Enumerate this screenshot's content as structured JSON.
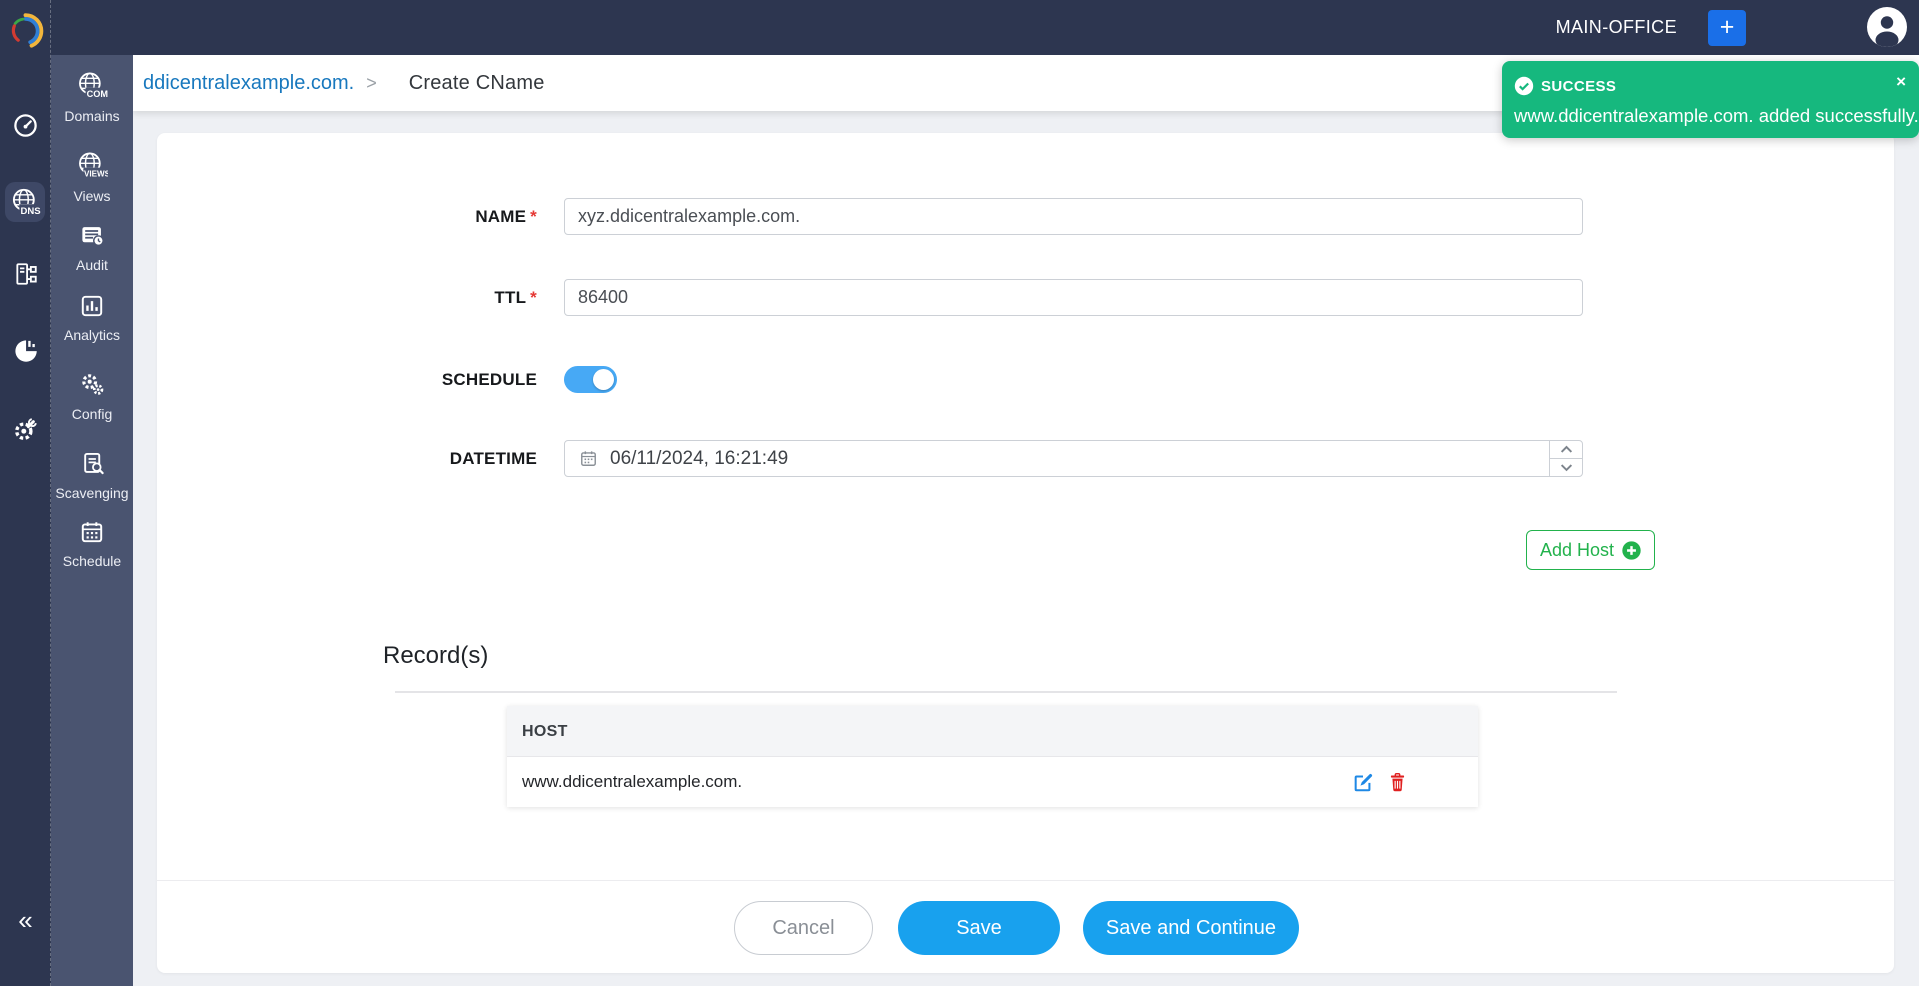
{
  "topbar": {
    "org_label": "MAIN-OFFICE",
    "add_button_label": "+"
  },
  "toast": {
    "status": "SUCCESS",
    "message": "www.ddicentralexample.com. added successfully.",
    "close_label": "×"
  },
  "breadcrumb": {
    "domain_link": "ddicentralexample.com.",
    "separator": ">",
    "current_page": "Create CName"
  },
  "sidebar_primary": {
    "icons": [
      "logo-swirl-icon",
      "speedometer-icon",
      "dns-globe-icon",
      "server-nodes-icon",
      "pie-chart-icon",
      "gear-wrench-icon"
    ],
    "dns_icon_text": "DNS",
    "active_item": "dns",
    "collapse_label": "«"
  },
  "sidebar_secondary": {
    "items": [
      {
        "label": "Domains",
        "icon": "globe-com-icon",
        "icon_text": "COM"
      },
      {
        "label": "Views",
        "icon": "globe-views-icon",
        "icon_text": "VIEWS"
      },
      {
        "label": "Audit",
        "icon": "audit-list-clock-icon"
      },
      {
        "label": "Analytics",
        "icon": "bar-chart-icon"
      },
      {
        "label": "Config",
        "icon": "gears-icon"
      },
      {
        "label": "Scavenging",
        "icon": "document-search-icon"
      },
      {
        "label": "Schedule",
        "icon": "calendar-icon"
      }
    ]
  },
  "form": {
    "required_marker": "*",
    "name": {
      "label": "NAME",
      "value": "xyz.ddicentralexample.com.",
      "required": true
    },
    "ttl": {
      "label": "TTL",
      "value": "86400",
      "required": true
    },
    "schedule": {
      "label": "SCHEDULE",
      "enabled": true
    },
    "datetime": {
      "label": "DATETIME",
      "value": "06/11/2024, 16:21:49"
    },
    "add_host_label": "Add Host"
  },
  "records": {
    "heading": "Record(s)",
    "columns": [
      "HOST"
    ],
    "rows": [
      {
        "host": "www.ddicentralexample.com."
      }
    ]
  },
  "footer": {
    "cancel_label": "Cancel",
    "save_label": "Save",
    "save_continue_label": "Save and Continue"
  },
  "colors": {
    "topbar_bg": "#2d3650",
    "sidebar_secondary_bg": "#4a5470",
    "active_tile_bg": "#3e4866",
    "link_blue": "#1878be",
    "button_blue": "#18a1ee",
    "toggle_blue": "#47a9f5",
    "plus_button_blue": "#1a6fe8",
    "toast_green": "#16b87e",
    "add_host_green": "#22b24c",
    "edit_blue": "#1e88e5",
    "delete_red": "#e02020",
    "required_red": "#e53935",
    "page_bg": "#eef0f4"
  }
}
